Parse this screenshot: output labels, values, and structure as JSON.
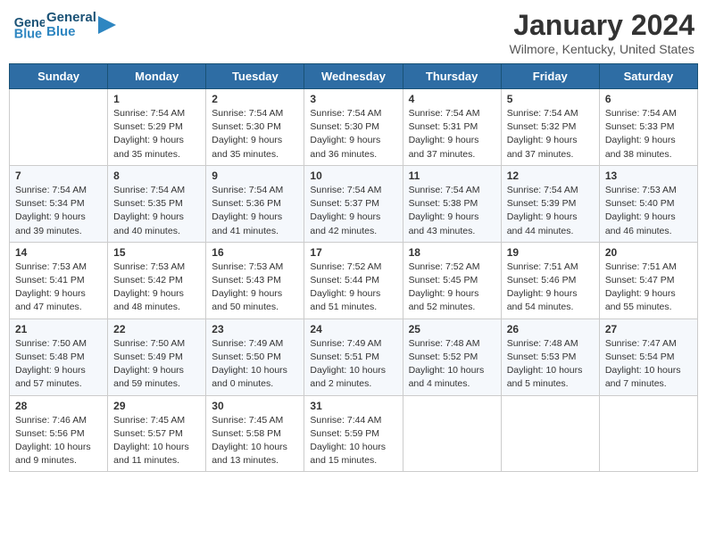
{
  "header": {
    "logo_line1": "General",
    "logo_line2": "Blue",
    "month_year": "January 2024",
    "location": "Wilmore, Kentucky, United States"
  },
  "weekdays": [
    "Sunday",
    "Monday",
    "Tuesday",
    "Wednesday",
    "Thursday",
    "Friday",
    "Saturday"
  ],
  "weeks": [
    [
      {
        "day": "",
        "sunrise": "",
        "sunset": "",
        "daylight": ""
      },
      {
        "day": "1",
        "sunrise": "Sunrise: 7:54 AM",
        "sunset": "Sunset: 5:29 PM",
        "daylight": "Daylight: 9 hours and 35 minutes."
      },
      {
        "day": "2",
        "sunrise": "Sunrise: 7:54 AM",
        "sunset": "Sunset: 5:30 PM",
        "daylight": "Daylight: 9 hours and 35 minutes."
      },
      {
        "day": "3",
        "sunrise": "Sunrise: 7:54 AM",
        "sunset": "Sunset: 5:30 PM",
        "daylight": "Daylight: 9 hours and 36 minutes."
      },
      {
        "day": "4",
        "sunrise": "Sunrise: 7:54 AM",
        "sunset": "Sunset: 5:31 PM",
        "daylight": "Daylight: 9 hours and 37 minutes."
      },
      {
        "day": "5",
        "sunrise": "Sunrise: 7:54 AM",
        "sunset": "Sunset: 5:32 PM",
        "daylight": "Daylight: 9 hours and 37 minutes."
      },
      {
        "day": "6",
        "sunrise": "Sunrise: 7:54 AM",
        "sunset": "Sunset: 5:33 PM",
        "daylight": "Daylight: 9 hours and 38 minutes."
      }
    ],
    [
      {
        "day": "7",
        "sunrise": "Sunrise: 7:54 AM",
        "sunset": "Sunset: 5:34 PM",
        "daylight": "Daylight: 9 hours and 39 minutes."
      },
      {
        "day": "8",
        "sunrise": "Sunrise: 7:54 AM",
        "sunset": "Sunset: 5:35 PM",
        "daylight": "Daylight: 9 hours and 40 minutes."
      },
      {
        "day": "9",
        "sunrise": "Sunrise: 7:54 AM",
        "sunset": "Sunset: 5:36 PM",
        "daylight": "Daylight: 9 hours and 41 minutes."
      },
      {
        "day": "10",
        "sunrise": "Sunrise: 7:54 AM",
        "sunset": "Sunset: 5:37 PM",
        "daylight": "Daylight: 9 hours and 42 minutes."
      },
      {
        "day": "11",
        "sunrise": "Sunrise: 7:54 AM",
        "sunset": "Sunset: 5:38 PM",
        "daylight": "Daylight: 9 hours and 43 minutes."
      },
      {
        "day": "12",
        "sunrise": "Sunrise: 7:54 AM",
        "sunset": "Sunset: 5:39 PM",
        "daylight": "Daylight: 9 hours and 44 minutes."
      },
      {
        "day": "13",
        "sunrise": "Sunrise: 7:53 AM",
        "sunset": "Sunset: 5:40 PM",
        "daylight": "Daylight: 9 hours and 46 minutes."
      }
    ],
    [
      {
        "day": "14",
        "sunrise": "Sunrise: 7:53 AM",
        "sunset": "Sunset: 5:41 PM",
        "daylight": "Daylight: 9 hours and 47 minutes."
      },
      {
        "day": "15",
        "sunrise": "Sunrise: 7:53 AM",
        "sunset": "Sunset: 5:42 PM",
        "daylight": "Daylight: 9 hours and 48 minutes."
      },
      {
        "day": "16",
        "sunrise": "Sunrise: 7:53 AM",
        "sunset": "Sunset: 5:43 PM",
        "daylight": "Daylight: 9 hours and 50 minutes."
      },
      {
        "day": "17",
        "sunrise": "Sunrise: 7:52 AM",
        "sunset": "Sunset: 5:44 PM",
        "daylight": "Daylight: 9 hours and 51 minutes."
      },
      {
        "day": "18",
        "sunrise": "Sunrise: 7:52 AM",
        "sunset": "Sunset: 5:45 PM",
        "daylight": "Daylight: 9 hours and 52 minutes."
      },
      {
        "day": "19",
        "sunrise": "Sunrise: 7:51 AM",
        "sunset": "Sunset: 5:46 PM",
        "daylight": "Daylight: 9 hours and 54 minutes."
      },
      {
        "day": "20",
        "sunrise": "Sunrise: 7:51 AM",
        "sunset": "Sunset: 5:47 PM",
        "daylight": "Daylight: 9 hours and 55 minutes."
      }
    ],
    [
      {
        "day": "21",
        "sunrise": "Sunrise: 7:50 AM",
        "sunset": "Sunset: 5:48 PM",
        "daylight": "Daylight: 9 hours and 57 minutes."
      },
      {
        "day": "22",
        "sunrise": "Sunrise: 7:50 AM",
        "sunset": "Sunset: 5:49 PM",
        "daylight": "Daylight: 9 hours and 59 minutes."
      },
      {
        "day": "23",
        "sunrise": "Sunrise: 7:49 AM",
        "sunset": "Sunset: 5:50 PM",
        "daylight": "Daylight: 10 hours and 0 minutes."
      },
      {
        "day": "24",
        "sunrise": "Sunrise: 7:49 AM",
        "sunset": "Sunset: 5:51 PM",
        "daylight": "Daylight: 10 hours and 2 minutes."
      },
      {
        "day": "25",
        "sunrise": "Sunrise: 7:48 AM",
        "sunset": "Sunset: 5:52 PM",
        "daylight": "Daylight: 10 hours and 4 minutes."
      },
      {
        "day": "26",
        "sunrise": "Sunrise: 7:48 AM",
        "sunset": "Sunset: 5:53 PM",
        "daylight": "Daylight: 10 hours and 5 minutes."
      },
      {
        "day": "27",
        "sunrise": "Sunrise: 7:47 AM",
        "sunset": "Sunset: 5:54 PM",
        "daylight": "Daylight: 10 hours and 7 minutes."
      }
    ],
    [
      {
        "day": "28",
        "sunrise": "Sunrise: 7:46 AM",
        "sunset": "Sunset: 5:56 PM",
        "daylight": "Daylight: 10 hours and 9 minutes."
      },
      {
        "day": "29",
        "sunrise": "Sunrise: 7:45 AM",
        "sunset": "Sunset: 5:57 PM",
        "daylight": "Daylight: 10 hours and 11 minutes."
      },
      {
        "day": "30",
        "sunrise": "Sunrise: 7:45 AM",
        "sunset": "Sunset: 5:58 PM",
        "daylight": "Daylight: 10 hours and 13 minutes."
      },
      {
        "day": "31",
        "sunrise": "Sunrise: 7:44 AM",
        "sunset": "Sunset: 5:59 PM",
        "daylight": "Daylight: 10 hours and 15 minutes."
      },
      {
        "day": "",
        "sunrise": "",
        "sunset": "",
        "daylight": ""
      },
      {
        "day": "",
        "sunrise": "",
        "sunset": "",
        "daylight": ""
      },
      {
        "day": "",
        "sunrise": "",
        "sunset": "",
        "daylight": ""
      }
    ]
  ]
}
